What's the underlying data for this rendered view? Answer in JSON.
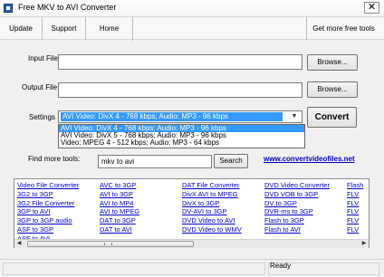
{
  "window": {
    "title": "Free MKV to AVI Converter",
    "close_label": "✕"
  },
  "toolbar": {
    "update": "Update",
    "support": "Support",
    "home": "Home",
    "more_tools": "Get more free tools"
  },
  "form": {
    "input_label": "Input File",
    "output_label": "Output File",
    "settings_label": "Settings",
    "browse_label": "Browse...",
    "input_value": "",
    "output_value": "",
    "settings_value": "AVI Video: DivX 4 - 768 kbps; Audio: MP3 - 96 kbps",
    "settings_options": [
      "AVI Video: DivX 4 - 768 kbps; Audio: MP3 - 96 kbps",
      "AVI Video: DivX 5 - 768 kbps; Audio: MP3 - 96 kbps",
      "Video: MPEG 4 - 512 kbps; Audio: MP3 - 64 kbps"
    ],
    "convert_label": "Convert"
  },
  "search": {
    "label": "Find more tools:",
    "value": "mkv to avi",
    "button": "Search",
    "website": "www.convertvideofiles.net"
  },
  "links": {
    "columns": [
      [
        "Video File Converter",
        "3G2 to 3GP",
        "3G2 File Converter",
        "3GP to AVI",
        "3GP to 3GP audio",
        "ASF to 3GP",
        "ASF to AVI"
      ],
      [
        "AVC to 3GP",
        "AVI to 3GP",
        "AVI to MP4",
        "AVI to MPEG",
        "DAT to 3GP",
        "DAT to AVI"
      ],
      [
        "DAT File Converter",
        "DivX AVI to MPEG",
        "DivX to 3GP",
        "DV-AVI to 3GP",
        "DVD Video to AVI",
        "DVD Video to WMV"
      ],
      [
        "DVD Video Converter",
        "DVD VOB to 3GP",
        "DV to 3GP",
        "DVR-ms to 3GP",
        "Flash to 3GP",
        "Flash to AVI"
      ],
      [
        "Flash",
        "FLV",
        "FLV",
        "FLV",
        "FLV",
        "FLV"
      ]
    ]
  },
  "status": {
    "text": "Ready"
  }
}
